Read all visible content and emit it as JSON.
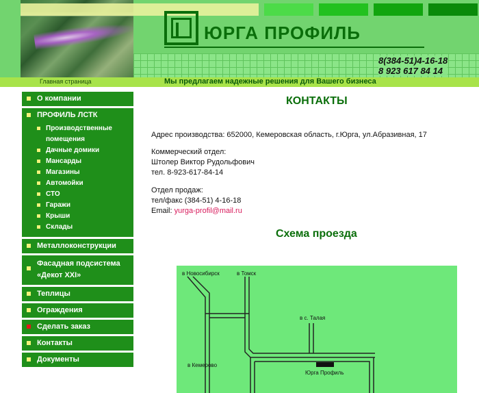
{
  "header": {
    "logo_text": "ЮРГА ПРОФИЛЬ",
    "phone1": "8(384-51)4-16-18",
    "phone2": "8 923 617 84 14",
    "home_link": "Главная страница",
    "slogan": "Мы предлагаем надежные решения для Вашего бизнеса"
  },
  "nav": {
    "about": "О компании",
    "profile_group": "ПРОФИЛЬ ЛСТК",
    "sub": [
      "Производственные помещения",
      "Дачные домики",
      "Мансарды",
      "Магазины",
      "Автомойки",
      "СТО",
      "Гаражи",
      "Крыши",
      "Склады"
    ],
    "metal": "Металлоконструкции",
    "facade": "Фасадная подсистема «Декот XXI»",
    "greenhouses": "Теплицы",
    "fences": "Ограждения",
    "order": "Сделать заказ",
    "contacts": "Контакты",
    "documents": "Документы"
  },
  "content": {
    "title": "КОНТАКТЫ",
    "address": "Адрес производства: 652000, Кемеровская область, г.Юрга, ул.Абразивная, 17",
    "commerce_label": "Коммерческий отдел:",
    "commerce_name": "Штолер Виктор Рудольфович",
    "commerce_phone": "тел. 8-923-617-84-14",
    "sales_label": "Отдел продаж:",
    "sales_phone": "тел/факс (384-51) 4-16-18",
    "email_label": "Email: ",
    "email": "yurga-profil@mail.ru",
    "scheme_title": "Схема проезда"
  },
  "map": {
    "novosibirsk": "в Новосибирск",
    "tomsk": "в Томск",
    "talaya": "в с. Талая",
    "kemerovo": "в Кемерово",
    "yurga": "Юрга Профиль"
  }
}
